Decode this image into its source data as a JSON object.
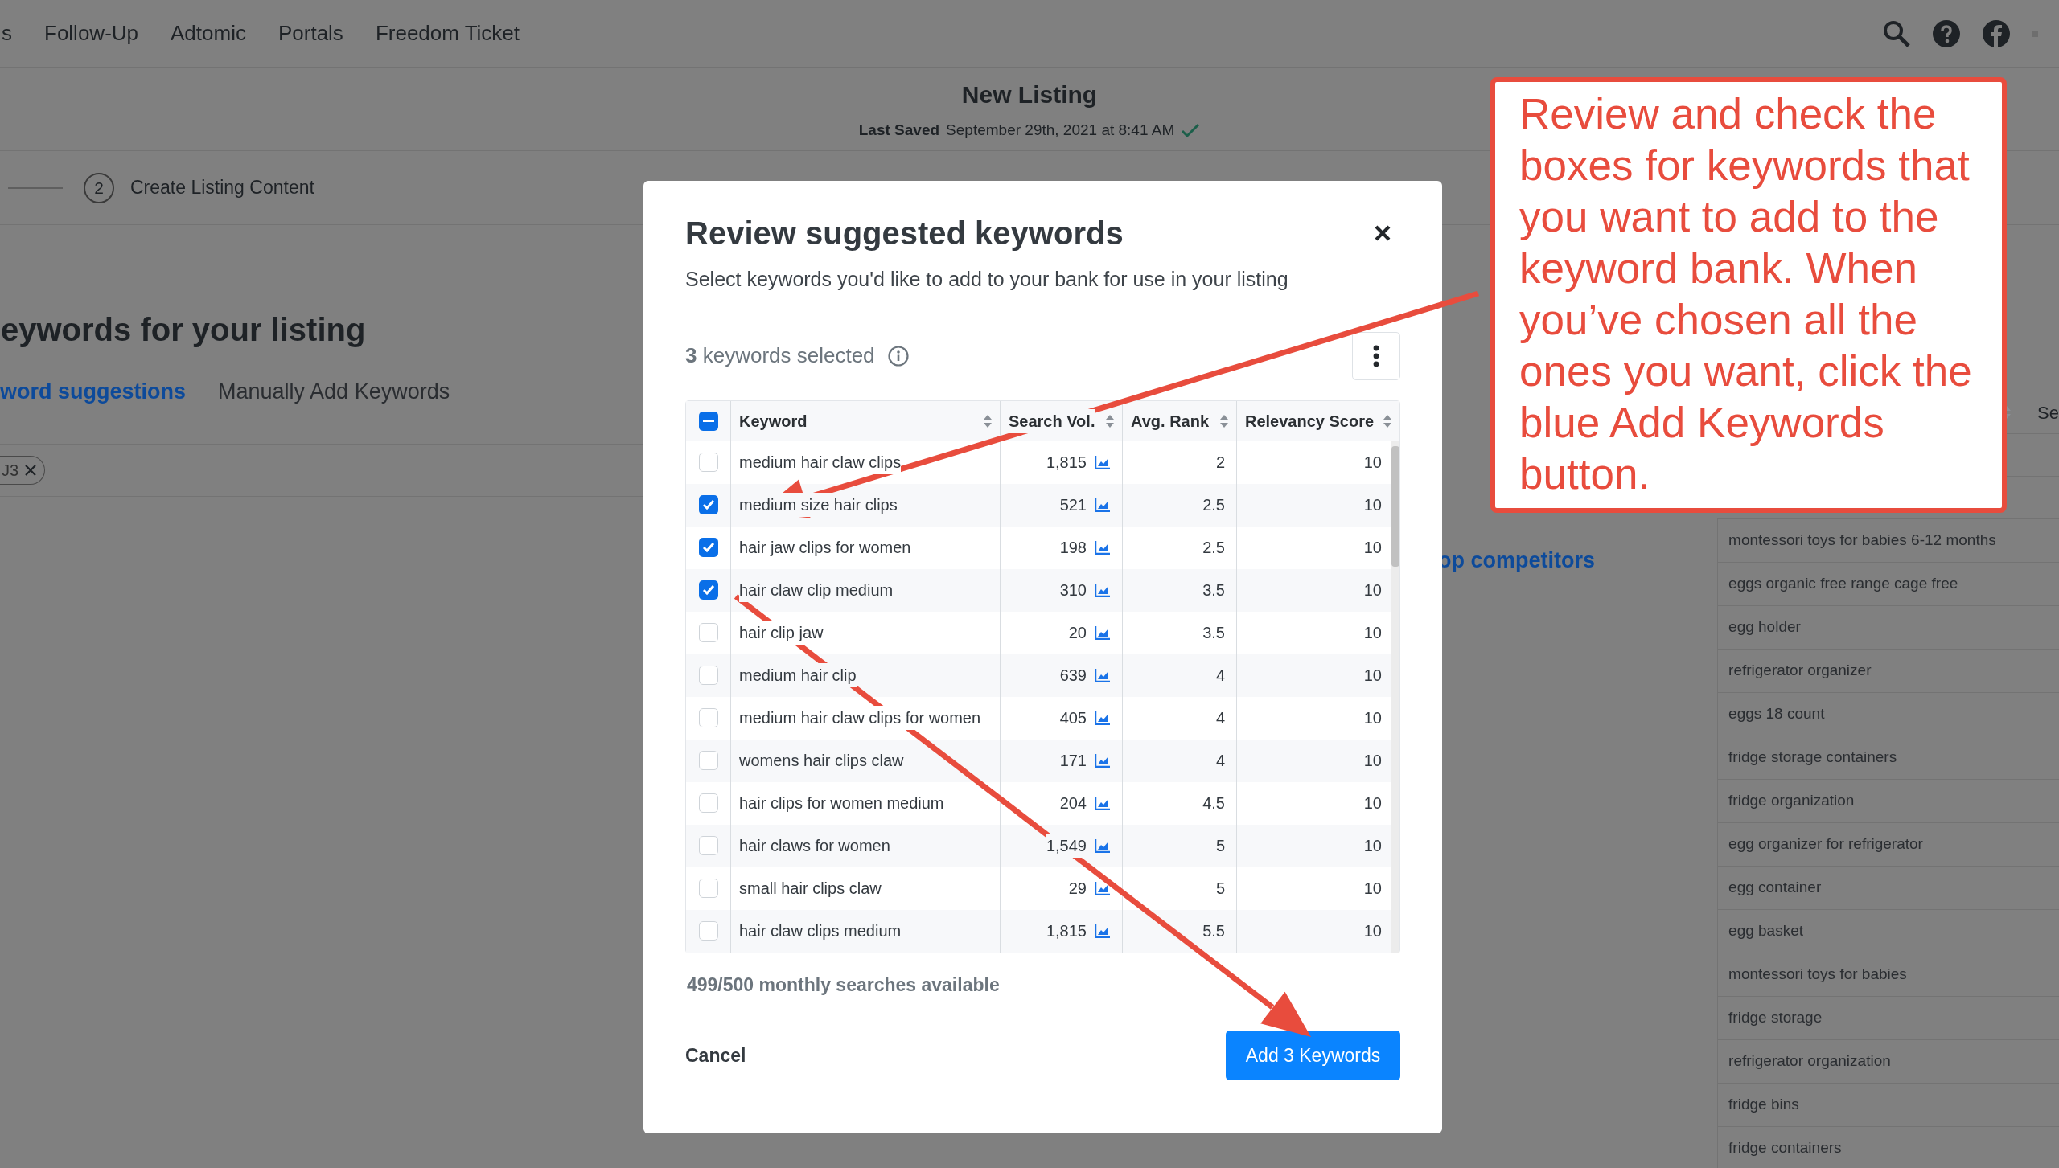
{
  "nav": {
    "items": [
      "s",
      "Follow-Up",
      "Adtomic",
      "Portals",
      "Freedom Ticket"
    ]
  },
  "header": {
    "title": "New Listing",
    "saved_label": "Last Saved",
    "saved_value": "September 29th, 2021 at 8:41 AM"
  },
  "step": {
    "number": "2",
    "label": "Create Listing Content"
  },
  "section": {
    "heading": "eywords for your listing",
    "tabs": [
      {
        "label": "word suggestions",
        "selected": true
      },
      {
        "label": "Manually Add Keywords",
        "selected": false
      }
    ],
    "chip": "J3",
    "link": "op competitors"
  },
  "side_table": {
    "column_2": "Se",
    "rows": [
      "montessori toys for babies 6-12 months",
      "eggs organic free range cage free",
      "egg holder",
      "refrigerator organizer",
      "eggs 18 count",
      "fridge storage containers",
      "fridge organization",
      "egg organizer for refrigerator",
      "egg container",
      "egg basket",
      "montessori toys for babies",
      "fridge storage",
      "refrigerator organization",
      "fridge bins",
      "fridge containers"
    ]
  },
  "modal": {
    "title": "Review suggested keywords",
    "subtitle": "Select keywords you'd like to add to your bank for use in your listing",
    "selected_text": "**3** keywords selected",
    "select_all": {
      "checked": true,
      "indeterminate": true
    },
    "columns": [
      "Keyword",
      "Search Vol.",
      "Avg. Rank",
      "Relevancy Score"
    ],
    "rows": [
      {
        "keyword": "medium hair claw clips",
        "search_vol": "1,815",
        "avg_rank": "2",
        "relevancy": "10",
        "checked": false
      },
      {
        "keyword": "medium size hair clips",
        "search_vol": "521",
        "avg_rank": "2.5",
        "relevancy": "10",
        "checked": true
      },
      {
        "keyword": "hair jaw clips for women",
        "search_vol": "198",
        "avg_rank": "2.5",
        "relevancy": "10",
        "checked": true
      },
      {
        "keyword": "hair claw clip medium",
        "search_vol": "310",
        "avg_rank": "3.5",
        "relevancy": "10",
        "checked": true
      },
      {
        "keyword": "hair clip jaw",
        "search_vol": "20",
        "avg_rank": "3.5",
        "relevancy": "10",
        "checked": false
      },
      {
        "keyword": "medium hair clip",
        "search_vol": "639",
        "avg_rank": "4",
        "relevancy": "10",
        "checked": false
      },
      {
        "keyword": "medium hair claw clips for women",
        "search_vol": "405",
        "avg_rank": "4",
        "relevancy": "10",
        "checked": false
      },
      {
        "keyword": "womens hair clips claw",
        "search_vol": "171",
        "avg_rank": "4",
        "relevancy": "10",
        "checked": false
      },
      {
        "keyword": "hair clips for women medium",
        "search_vol": "204",
        "avg_rank": "4.5",
        "relevancy": "10",
        "checked": false
      },
      {
        "keyword": "hair claws for women",
        "search_vol": "1,549",
        "avg_rank": "5",
        "relevancy": "10",
        "checked": false
      },
      {
        "keyword": "small hair clips claw",
        "search_vol": "29",
        "avg_rank": "5",
        "relevancy": "10",
        "checked": false
      },
      {
        "keyword": "hair claw clips medium",
        "search_vol": "1,815",
        "avg_rank": "5.5",
        "relevancy": "10",
        "checked": false
      }
    ],
    "quota": "499/500 monthly searches available",
    "cancel": "Cancel",
    "add": "Add 3 Keywords"
  },
  "callout": {
    "text": "Review and check the boxes for keywords that you want to add to the keyword bank. When you’ve chosen all the ones you want, click the blue Add Keywords button."
  }
}
